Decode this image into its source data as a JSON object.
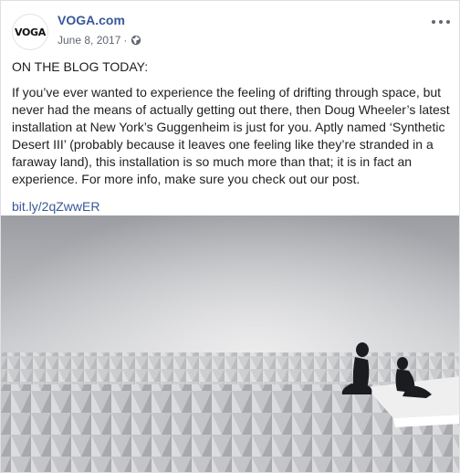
{
  "post": {
    "page_name": "VOGA.com",
    "avatar_text": "VOGA",
    "date": "June 8, 2017",
    "separator": "·",
    "privacy_icon": "globe-icon",
    "more_icon": "more-options-icon",
    "heading": "ON THE BLOG TODAY:",
    "paragraph": "If you’ve ever wanted to experience the feeling of drifting through space, but never had the means of actually getting out there, then Doug Wheeler’s latest installation at New York’s Guggenheim is just for you. Aptly named ‘Synthetic Desert III’ (probably because it leaves one feeling like they’re stranded in a faraway land), this installation is so much more than that; it is in fact an experience. For more info, make sure you check out our post.",
    "link": "bit.ly/2qZwwER",
    "colors": {
      "link": "#385898",
      "meta": "#606770",
      "text": "#1c1e21"
    }
  }
}
